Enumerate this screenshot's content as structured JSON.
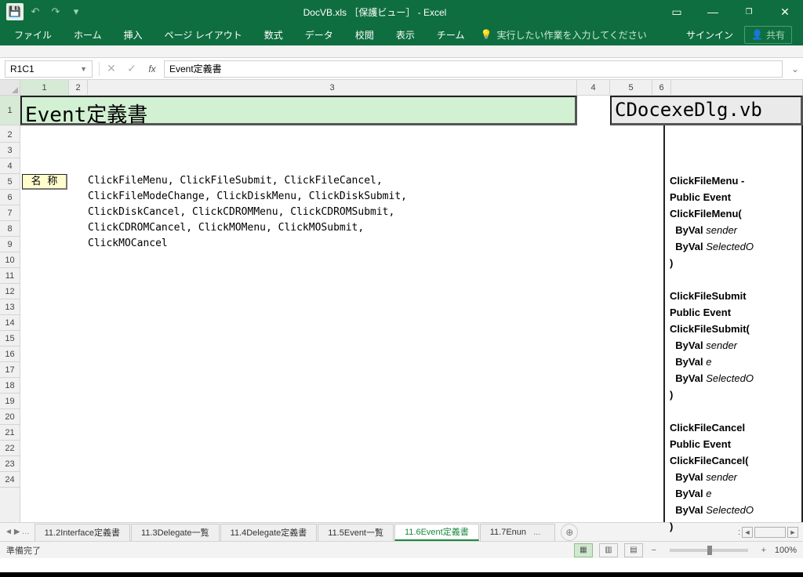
{
  "title": "DocVB.xls ［保護ビュー］ - Excel",
  "qat": {
    "undo": "↶",
    "redo": "↷",
    "dropdown": "▾"
  },
  "wc": {
    "ribbon_opts": "▭",
    "min": "—",
    "restore": "❐",
    "close": "✕"
  },
  "tabs": {
    "file": "ファイル",
    "home": "ホーム",
    "insert": "挿入",
    "page_layout": "ページ レイアウト",
    "formulas": "数式",
    "data": "データ",
    "review": "校閲",
    "view": "表示",
    "team": "チーム"
  },
  "tell_me": {
    "icon": "💡",
    "text": "実行したい作業を入力してください"
  },
  "signin": "サインイン",
  "share": {
    "icon": "👤",
    "text": "共有"
  },
  "namebox": "R1C1",
  "fb": {
    "cancel": "✕",
    "enter": "✓",
    "fx": "fx"
  },
  "formula": "Event定義書",
  "cols": {
    "c1": "1",
    "c2": "2",
    "c3": "3",
    "c4": "4",
    "c5": "5",
    "c6": "6"
  },
  "rows": [
    "1",
    "2",
    "3",
    "4",
    "5",
    "6",
    "7",
    "8",
    "9",
    "10",
    "11",
    "12",
    "13",
    "14",
    "15",
    "16",
    "17",
    "18",
    "19",
    "20",
    "21",
    "22",
    "23",
    "24"
  ],
  "cells": {
    "title": "Event定義書",
    "file": "CDocexeDlg.vb",
    "name_label": "名 称",
    "body": "ClickFileMenu, ClickFileSubmit, ClickFileCancel,\nClickFileModeChange, ClickDiskMenu, ClickDiskSubmit,\nClickDiskCancel, ClickCDROMMenu, ClickCDROMSubmit,\nClickCDROMCancel, ClickMOMenu, ClickMOSubmit,\nClickMOCancel"
  },
  "side": {
    "l1": "ClickFileMenu -",
    "l2": "Public Event",
    "l3": "ClickFileMenu(",
    "l4": "  ByVal ",
    "l4i": "sender",
    "l5": "  ByVal ",
    "l5i": "SelectedO",
    "l6": ")",
    "l7": "",
    "l8": "ClickFileSubmit",
    "l9": "Public Event",
    "l10": "ClickFileSubmit(",
    "l11": "  ByVal ",
    "l11i": "sender",
    "l12": "  ByVal ",
    "l12i": "e",
    "l13": "  ByVal ",
    "l13i": "SelectedO",
    "l14": ")",
    "l15": "",
    "l16": "ClickFileCancel",
    "l17": "Public Event",
    "l18": "ClickFileCancel(",
    "l19": "  ByVal ",
    "l19i": "sender",
    "l20": "  ByVal ",
    "l20i": "e",
    "l21": "  ByVal ",
    "l21i": "SelectedO",
    "l22": ")"
  },
  "sheets": {
    "s1": "11.2Interface定義書",
    "s2": "11.3Delegate一覧",
    "s3": "11.4Delegate定義書",
    "s4": "11.5Event一覧",
    "s5": "11.6Event定義書",
    "s6": "11.7Enun"
  },
  "sheet_nav": {
    "first": "◄",
    "prev": "…",
    "more": "..."
  },
  "sheet_scroll": {
    "left": "◄",
    "right": "►",
    "sep": ":"
  },
  "status": "準備完了",
  "view": {
    "normal": "▦",
    "page": "▥",
    "break": "▤"
  },
  "zoom": {
    "minus": "−",
    "plus": "+",
    "pct": "100%"
  }
}
